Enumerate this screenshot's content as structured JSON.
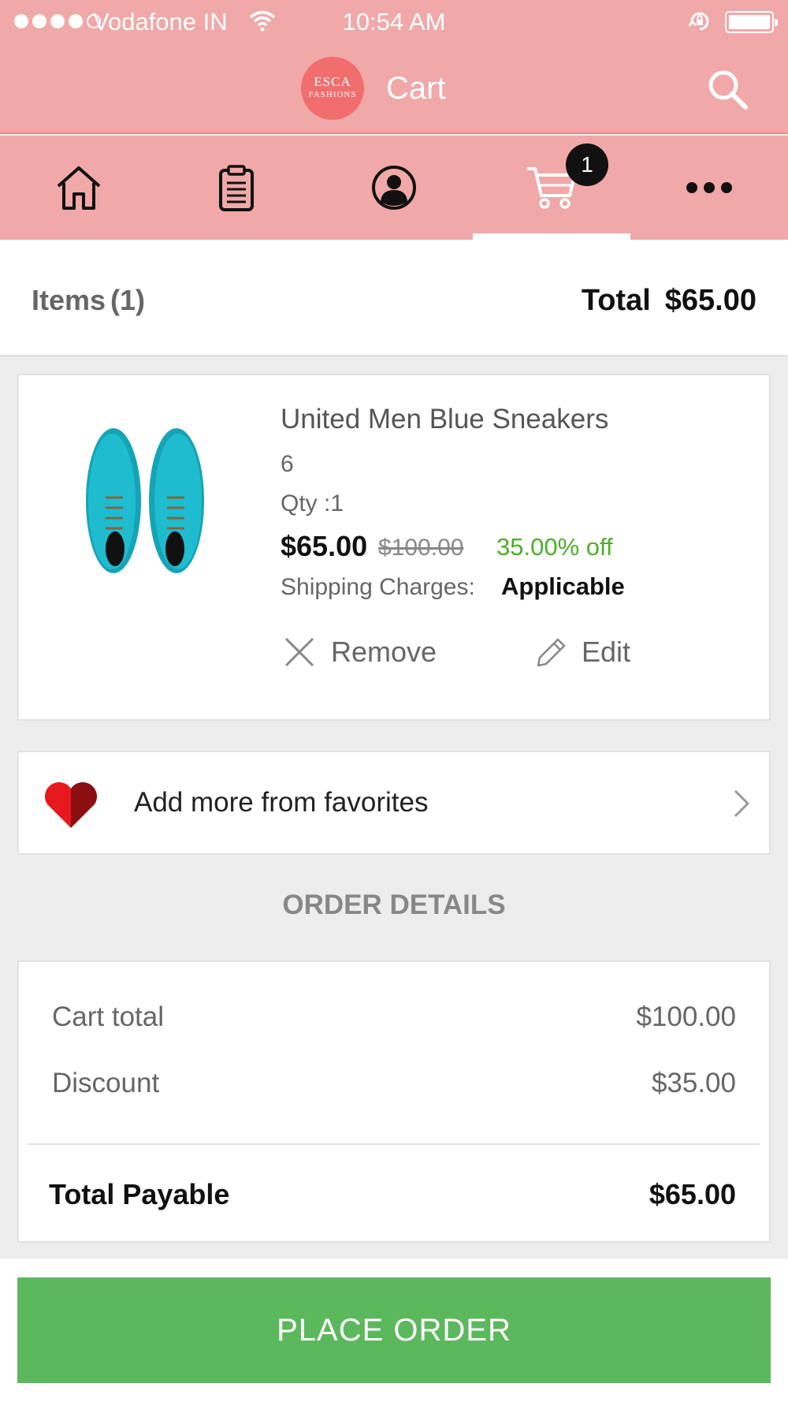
{
  "status_bar": {
    "carrier": "Vodafone IN",
    "time": "10:54 AM"
  },
  "nav": {
    "logo_line1": "ESCA",
    "logo_line2": "FASHIONS",
    "title": "Cart"
  },
  "tabs": {
    "items": [
      {
        "name": "home",
        "icon": "home-icon"
      },
      {
        "name": "orders",
        "icon": "clipboard-icon"
      },
      {
        "name": "account",
        "icon": "user-icon"
      },
      {
        "name": "cart",
        "icon": "cart-icon",
        "active": true
      },
      {
        "name": "more",
        "icon": "more-icon"
      }
    ],
    "cart_badge": "1"
  },
  "summary": {
    "items_label": "Items",
    "items_count": "(1)",
    "total_label": "Total",
    "total_value": "$65.00"
  },
  "product": {
    "name": "United Men Blue Sneakers",
    "size": "6",
    "qty": "Qty :1",
    "price": "$65.00",
    "original_price": "$100.00",
    "discount": "35.00% off",
    "shipping_label": "Shipping Charges:",
    "shipping_value": "Applicable",
    "remove_label": "Remove",
    "edit_label": "Edit",
    "image": "blue-sneakers-image"
  },
  "favorites": {
    "label": "Add more from favorites"
  },
  "order_details": {
    "title": "ORDER DETAILS",
    "cart_total_label": "Cart total",
    "cart_total_value": "$100.00",
    "discount_label": "Discount",
    "discount_value": "$35.00",
    "total_payable_label": "Total Payable",
    "total_payable_value": "$65.00"
  },
  "place_order": {
    "label": "PLACE ORDER"
  },
  "colors": {
    "header": "#f0a8a8",
    "logo": "#f26d6d",
    "discount": "#4caf2a",
    "place_order": "#5cb85c"
  }
}
